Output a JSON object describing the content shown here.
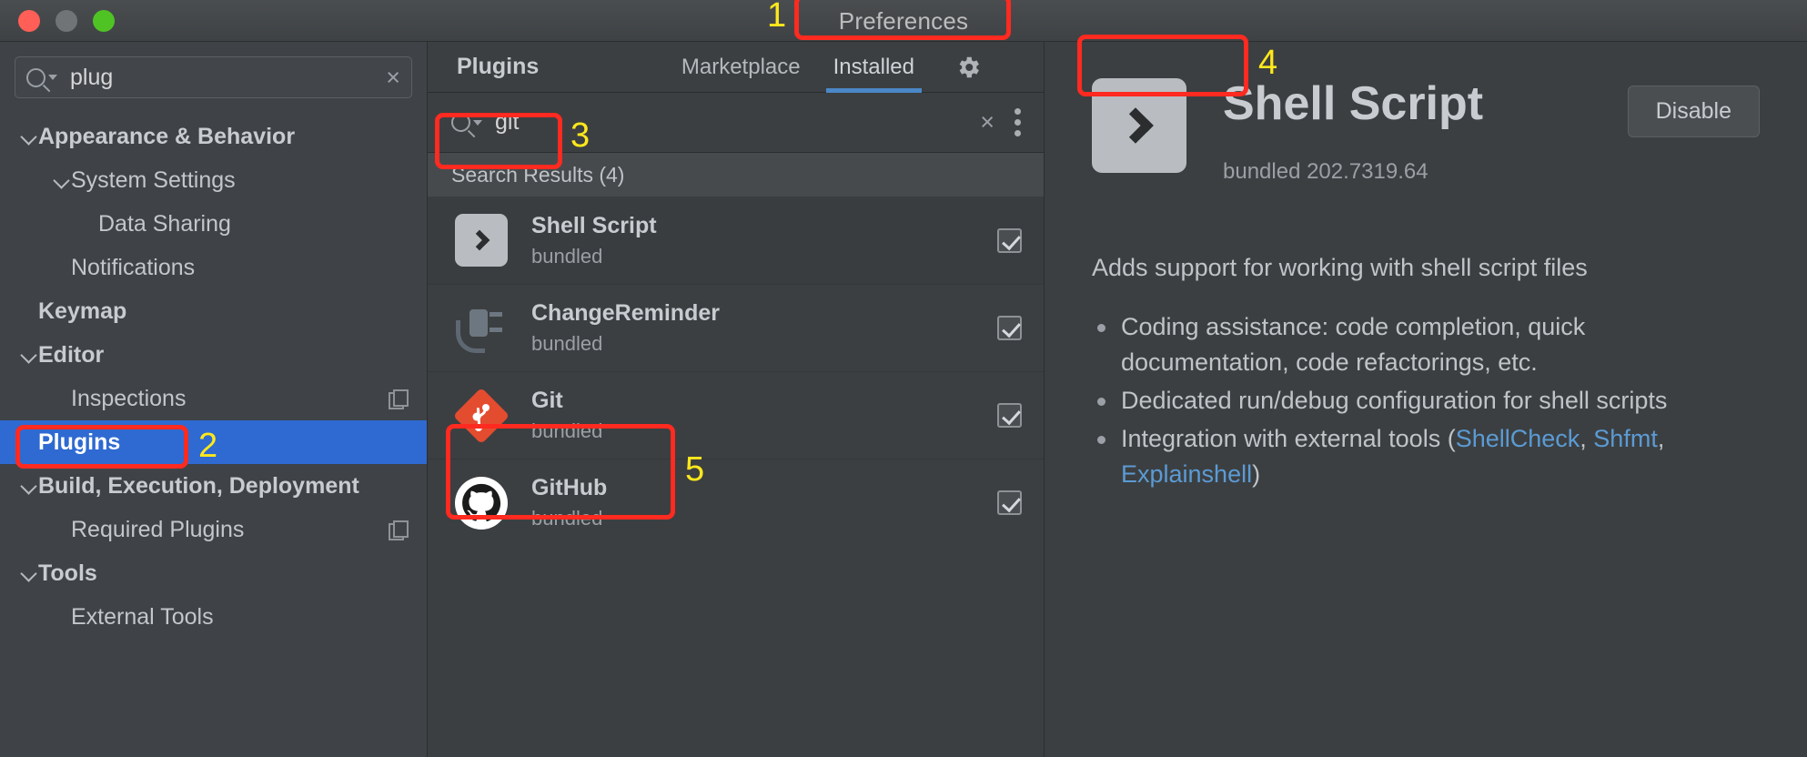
{
  "window": {
    "title": "Preferences",
    "traffic_lights": [
      "close-button",
      "minimize-button",
      "zoom-button"
    ]
  },
  "sidebar": {
    "search": {
      "value": "plug",
      "clear_label": "×"
    },
    "items": [
      {
        "label": "Appearance & Behavior",
        "level": 0,
        "bold": true,
        "chevron": true,
        "selected": false,
        "copy_icon": false
      },
      {
        "label": "System Settings",
        "level": 1,
        "bold": false,
        "chevron": true,
        "selected": false,
        "copy_icon": false
      },
      {
        "label": "Data Sharing",
        "level": 2,
        "bold": false,
        "chevron": false,
        "selected": false,
        "copy_icon": false
      },
      {
        "label": "Notifications",
        "level": 1,
        "bold": false,
        "chevron": false,
        "selected": false,
        "copy_icon": false
      },
      {
        "label": "Keymap",
        "level": 0,
        "bold": true,
        "chevron": false,
        "selected": false,
        "copy_icon": false
      },
      {
        "label": "Editor",
        "level": 0,
        "bold": true,
        "chevron": true,
        "selected": false,
        "copy_icon": false
      },
      {
        "label": "Inspections",
        "level": 1,
        "bold": false,
        "chevron": false,
        "selected": false,
        "copy_icon": true
      },
      {
        "label": "Plugins",
        "level": 0,
        "bold": true,
        "chevron": false,
        "selected": true,
        "copy_icon": false
      },
      {
        "label": "Build, Execution, Deployment",
        "level": 0,
        "bold": true,
        "chevron": true,
        "selected": false,
        "copy_icon": false
      },
      {
        "label": "Required Plugins",
        "level": 1,
        "bold": false,
        "chevron": false,
        "selected": false,
        "copy_icon": true
      },
      {
        "label": "Tools",
        "level": 0,
        "bold": true,
        "chevron": true,
        "selected": false,
        "copy_icon": false
      },
      {
        "label": "External Tools",
        "level": 1,
        "bold": false,
        "chevron": false,
        "selected": false,
        "copy_icon": false
      }
    ]
  },
  "plugins_panel": {
    "header_title": "Plugins",
    "tabs": [
      {
        "label": "Marketplace",
        "active": false
      },
      {
        "label": "Installed",
        "active": true
      }
    ],
    "gear_icon": "gear-icon",
    "search": {
      "value": "git",
      "clear_label": "×",
      "menu_icon": "kebab-menu-icon"
    },
    "results_header": "Search Results (4)",
    "rows": [
      {
        "name": "Shell Script",
        "status": "bundled",
        "icon": "shell-script-icon",
        "checked": true,
        "selected": true
      },
      {
        "name": "ChangeReminder",
        "status": "bundled",
        "icon": "change-reminder-icon",
        "checked": true,
        "selected": false
      },
      {
        "name": "Git",
        "status": "bundled",
        "icon": "git-icon",
        "checked": true,
        "selected": false
      },
      {
        "name": "GitHub",
        "status": "bundled",
        "icon": "github-icon",
        "checked": true,
        "selected": false
      }
    ]
  },
  "detail": {
    "icon": "shell-script-icon",
    "title": "Shell Script",
    "version": "bundled 202.7319.64",
    "action_button": "Disable",
    "description": "Adds support for working with shell script files",
    "bullets": [
      {
        "parts": [
          {
            "text": "Coding assistance: code completion, quick documentation, code refactorings, etc.",
            "link": false
          }
        ]
      },
      {
        "parts": [
          {
            "text": "Dedicated run/debug configuration for shell scripts",
            "link": false
          }
        ]
      },
      {
        "parts": [
          {
            "text": "Integration with external tools (",
            "link": false
          },
          {
            "text": "ShellCheck",
            "link": true
          },
          {
            "text": ", ",
            "link": false
          },
          {
            "text": "Shfmt",
            "link": true
          },
          {
            "text": ", ",
            "link": false
          },
          {
            "text": "Explainshell",
            "link": true
          },
          {
            "text": ")",
            "link": false
          }
        ]
      }
    ]
  },
  "annotations": {
    "numbers": [
      "1",
      "2",
      "3",
      "4",
      "5"
    ],
    "box_color": "#ff2a20",
    "number_color": "#ffe81c"
  }
}
